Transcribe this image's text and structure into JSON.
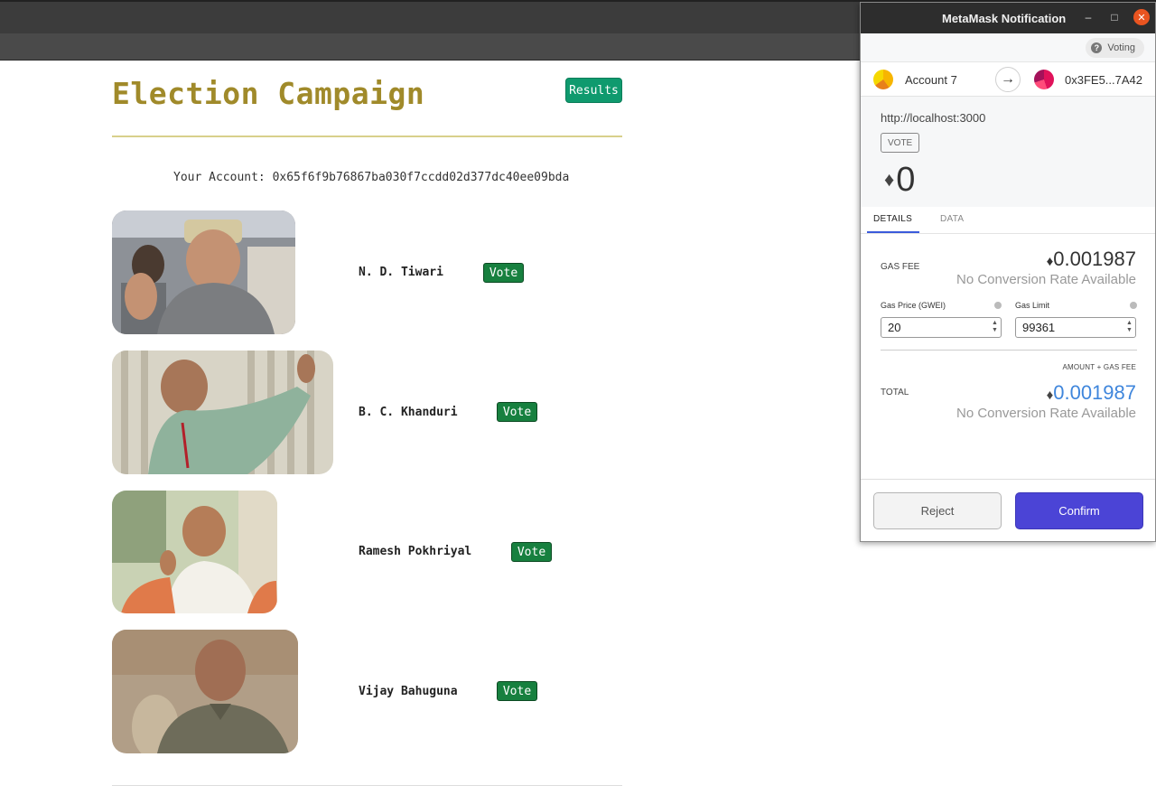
{
  "page": {
    "title": "Election Campaign",
    "results_label": "Results",
    "account_line": "Your Account: 0x65f6f9b76867ba030f7ccdd02d377dc40ee09bda"
  },
  "candidates": [
    {
      "name": "N. D. Tiwari",
      "vote_label": "Vote"
    },
    {
      "name": "B. C. Khanduri",
      "vote_label": "Vote"
    },
    {
      "name": "Ramesh Pokhriyal",
      "vote_label": "Vote"
    },
    {
      "name": "Vijay Bahuguna",
      "vote_label": "Vote"
    }
  ],
  "metamask": {
    "window_title": "MetaMask Notification",
    "window_controls": {
      "minimize": "–",
      "maximize": "□",
      "close": "✕"
    },
    "network_label": "Voting",
    "from_account": "Account 7",
    "to_address": "0x3FE5...7A42",
    "origin": "http://localhost:3000",
    "method": "VOTE",
    "amount": "0",
    "tabs": [
      "DETAILS",
      "DATA"
    ],
    "gas_fee_label": "GAS FEE",
    "gas_fee_value": "0.001987",
    "no_conversion": "No Conversion Rate Available",
    "gas_price_label": "Gas Price (GWEI)",
    "gas_price_value": "20",
    "gas_limit_label": "Gas Limit",
    "gas_limit_value": "99361",
    "amount_gas_label": "AMOUNT + GAS FEE",
    "total_label": "TOTAL",
    "total_value": "0.001987",
    "reject_label": "Reject",
    "confirm_label": "Confirm"
  },
  "colors": {
    "title": "#a08a2a",
    "results_button": "#0f9a6e",
    "vote_button": "#17803f",
    "confirm_button": "#4b44d6",
    "total_value": "#3f86dc"
  },
  "icons": {
    "eth": "ethereum-icon",
    "help": "help-icon",
    "arrow": "arrow-right-icon"
  }
}
